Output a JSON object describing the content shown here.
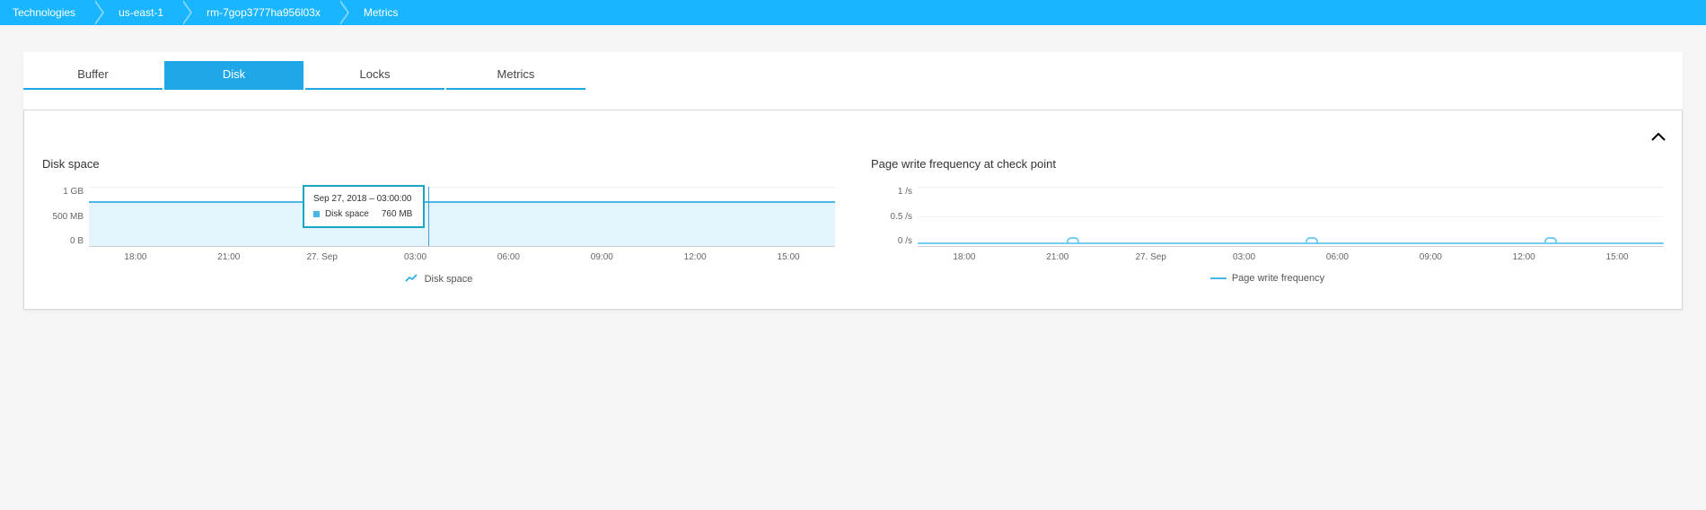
{
  "breadcrumbs": [
    "Technologies",
    "us-east-1",
    "rm-7gop3777ha956l03x",
    "Metrics"
  ],
  "tabs": [
    "Buffer",
    "Disk",
    "Locks",
    "Metrics"
  ],
  "active_tab": "Disk",
  "collapse_glyph": "˄",
  "charts": {
    "left": {
      "title": "Disk space",
      "legend": "Disk space",
      "tooltip": {
        "timestamp": "Sep 27, 2018 – 03:00:00",
        "series": "Disk space",
        "value": "760 MB"
      }
    },
    "right": {
      "title": "Page write frequency at check point",
      "legend": "Page write frequency"
    }
  },
  "chart_data": [
    {
      "type": "area",
      "title": "Disk space",
      "series": [
        {
          "name": "Disk space",
          "values_mb": [
            760,
            760,
            760,
            760,
            760,
            760,
            760,
            760,
            760
          ]
        }
      ],
      "x_ticks": [
        "18:00",
        "21:00",
        "27. Sep",
        "03:00",
        "06:00",
        "09:00",
        "12:00",
        "15:00"
      ],
      "y_ticks": [
        "1 GB",
        "500 MB",
        "0 B"
      ],
      "ylim_mb": [
        0,
        1024
      ],
      "hover": {
        "x_label": "03:00",
        "timestamp": "Sep 27, 2018 – 03:00:00",
        "value_mb": 760,
        "value_display": "760 MB"
      }
    },
    {
      "type": "line",
      "title": "Page write frequency at check point",
      "series": [
        {
          "name": "Page write frequency",
          "values_per_s": [
            0,
            0.05,
            0,
            0,
            0.05,
            0,
            0,
            0.05,
            0,
            0,
            0.05,
            0
          ]
        }
      ],
      "x_ticks": [
        "18:00",
        "21:00",
        "27. Sep",
        "03:00",
        "06:00",
        "09:00",
        "12:00",
        "15:00"
      ],
      "y_ticks": [
        "1 /s",
        "0.5 /s",
        "0 /s"
      ],
      "ylim_per_s": [
        0,
        1
      ]
    }
  ]
}
